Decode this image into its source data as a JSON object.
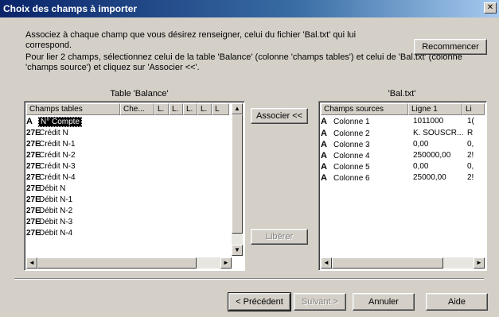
{
  "window": {
    "title": "Choix des champs à importer",
    "close_glyph": "✕"
  },
  "instructions": {
    "line1": "Associez à chaque champ que vous désirez renseigner, celui du fichier 'Bal.txt' qui lui",
    "line2": "correspond.",
    "line3": "Pour lier 2 champs, sélectionnez celui de la table 'Balance' (colonne 'champs tables') et celui de 'Bal.txt' (colonne",
    "line4": "'champs source') et cliquez sur 'Associer <<'."
  },
  "buttons": {
    "recommencer": "Recommencer",
    "associer": "Associer <<",
    "liberer": "Libérer",
    "precedent": "< Précédent",
    "suivant": "Suivant >",
    "annuler": "Annuler",
    "aide": "Aide"
  },
  "left_list": {
    "caption": "Table 'Balance'",
    "headers": [
      "Champs tables",
      "Che...",
      "L.",
      "L.",
      "L.",
      "L.",
      "L"
    ],
    "items": [
      {
        "icon": "A",
        "label": "N° Compte"
      },
      {
        "icon": "27E",
        "label": "Crédit N"
      },
      {
        "icon": "27E",
        "label": "Crédit N-1"
      },
      {
        "icon": "27E",
        "label": "Crédit N-2"
      },
      {
        "icon": "27E",
        "label": "Crédit N-3"
      },
      {
        "icon": "27E",
        "label": "Crédit N-4"
      },
      {
        "icon": "27E",
        "label": "Débit N"
      },
      {
        "icon": "27E",
        "label": "Débit N-1"
      },
      {
        "icon": "27E",
        "label": "Débit N-2"
      },
      {
        "icon": "27E",
        "label": "Débit N-3"
      },
      {
        "icon": "27E",
        "label": "Débit N-4"
      }
    ]
  },
  "right_list": {
    "caption": "'Bal.txt'",
    "headers": [
      "Champs sources",
      "Ligne 1",
      "Li"
    ],
    "rows": [
      {
        "icon": "A",
        "name": "Colonne 1",
        "ligne1": "1011000",
        "ligne2": "1("
      },
      {
        "icon": "A",
        "name": "Colonne 2",
        "ligne1": "K. SOUSCR...",
        "ligne2": "R"
      },
      {
        "icon": "A",
        "name": "Colonne 3",
        "ligne1": "0,00",
        "ligne2": "0,"
      },
      {
        "icon": "A",
        "name": "Colonne 4",
        "ligne1": "250000,00",
        "ligne2": "2!"
      },
      {
        "icon": "A",
        "name": "Colonne 5",
        "ligne1": "0,00",
        "ligne2": "0,"
      },
      {
        "icon": "A",
        "name": "Colonne 6",
        "ligne1": "25000,00",
        "ligne2": "2!"
      }
    ]
  },
  "scroll_glyphs": {
    "up": "▲",
    "down": "▼",
    "left": "◄",
    "right": "►"
  }
}
